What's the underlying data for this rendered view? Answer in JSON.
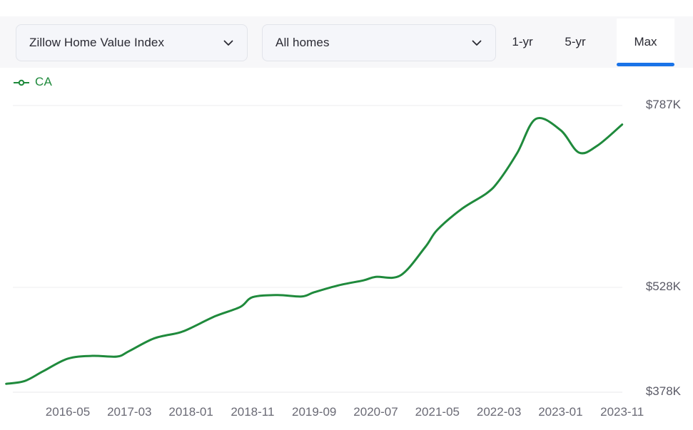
{
  "toolbar": {
    "metric_select": {
      "value": "Zillow Home Value Index",
      "icon": "chevron-down-icon"
    },
    "home_type_select": {
      "value": "All homes",
      "icon": "chevron-down-icon"
    },
    "range_tabs": [
      {
        "label": "1-yr",
        "active": false
      },
      {
        "label": "5-yr",
        "active": false
      },
      {
        "label": "Max",
        "active": true
      }
    ],
    "active_accent_color": "#1a73e8"
  },
  "legend": {
    "items": [
      {
        "label": "CA",
        "color": "#1f8a3c",
        "marker": "line-circle-marker"
      }
    ]
  },
  "chart_data": {
    "type": "line",
    "title": "",
    "xlabel": "",
    "ylabel": "",
    "grid": true,
    "legend_position": "top-left",
    "series_color": "#1f8a3c",
    "y_tick_labels": [
      "$787K",
      "$528K",
      "$378K"
    ],
    "y_tick_values": [
      787000,
      528000,
      378000
    ],
    "ylim": [
      378000,
      787000
    ],
    "x_tick_labels": [
      "2016-05",
      "2017-03",
      "2018-01",
      "2018-11",
      "2019-09",
      "2020-07",
      "2021-05",
      "2022-03",
      "2023-01",
      "2023-11"
    ],
    "series": [
      {
        "name": "CA",
        "x": [
          "2015-07",
          "2015-10",
          "2016-01",
          "2016-05",
          "2016-09",
          "2017-01",
          "2017-03",
          "2017-07",
          "2017-11",
          "2018-01",
          "2018-05",
          "2018-09",
          "2018-11",
          "2019-03",
          "2019-07",
          "2019-09",
          "2020-01",
          "2020-05",
          "2020-07",
          "2020-11",
          "2021-03",
          "2021-05",
          "2021-09",
          "2022-01",
          "2022-03",
          "2022-06",
          "2022-09",
          "2023-01",
          "2023-04",
          "2023-07",
          "2023-11"
        ],
        "values": [
          390000,
          394000,
          408000,
          426000,
          430000,
          429000,
          437000,
          455000,
          463000,
          470000,
          487000,
          500000,
          514000,
          517000,
          515000,
          521000,
          531000,
          538000,
          543000,
          545000,
          585000,
          610000,
          640000,
          662000,
          680000,
          720000,
          768000,
          752000,
          720000,
          730000,
          760000
        ]
      }
    ]
  }
}
